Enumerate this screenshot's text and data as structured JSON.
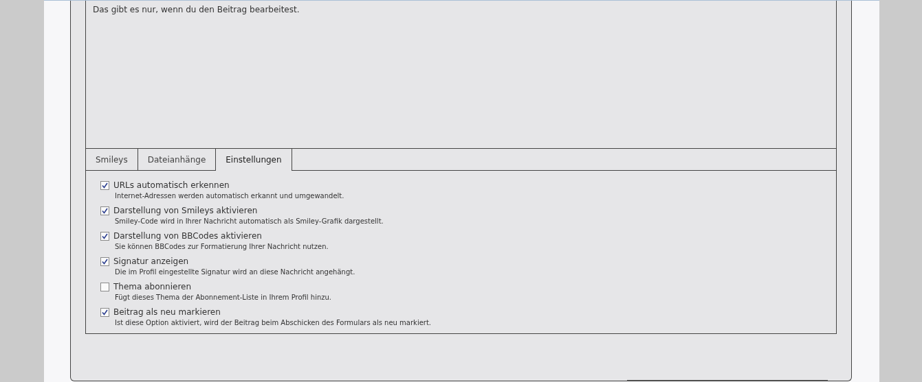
{
  "editor": {
    "text": "Das gibt es nur, wenn du den Beitrag bearbeitest."
  },
  "tabs": [
    {
      "label": "Smileys",
      "selected": false
    },
    {
      "label": "Dateianhänge",
      "selected": false
    },
    {
      "label": "Einstellungen",
      "selected": true
    }
  ],
  "options": [
    {
      "label": "URLs automatisch erkennen",
      "description": "Internet-Adressen werden automatisch erkannt und umgewandelt.",
      "checked": true
    },
    {
      "label": "Darstellung von Smileys aktivieren",
      "description": "Smiley-Code wird in Ihrer Nachricht automatisch als Smiley-Grafik dargestellt.",
      "checked": true
    },
    {
      "label": "Darstellung von BBCodes aktivieren",
      "description": "Sie können BBCodes zur Formatierung Ihrer Nachricht nutzen.",
      "checked": true
    },
    {
      "label": "Signatur anzeigen",
      "description": "Die im Profil eingestellte Signatur wird an diese Nachricht angehängt.",
      "checked": true
    },
    {
      "label": "Thema abonnieren",
      "description": "Fügt dieses Thema der Abonnement-Liste in Ihrem Profil hinzu.",
      "checked": false
    },
    {
      "label": "Beitrag als neu markieren",
      "description": "Ist diese Option aktiviert, wird der Beitrag beim Abschicken des Formulars als neu markiert.",
      "checked": true
    }
  ]
}
